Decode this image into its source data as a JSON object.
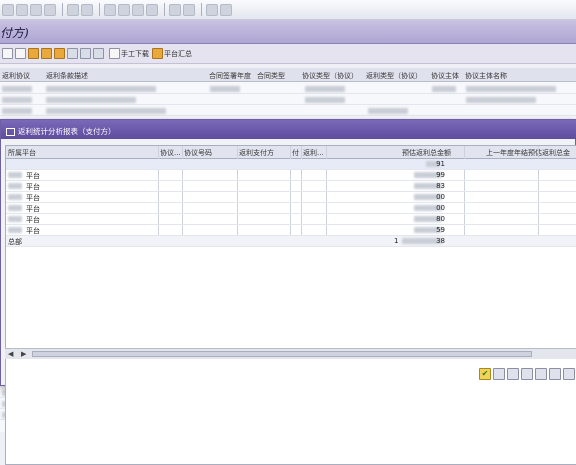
{
  "window": {
    "title": "付方)"
  },
  "toolbar": {
    "manual_download_label": "手工下载",
    "platform_summary_label": "平台汇总"
  },
  "background_table": {
    "columns": [
      "返利协议",
      "返利条款描述",
      "合同签署年度",
      "合同类型",
      "协议类型（协议）",
      "返利类型（协议）",
      "协议主体",
      "协议主体名称"
    ]
  },
  "dialog": {
    "title": "返利统计分析报表（支付方）",
    "columns": [
      "所属平台",
      "协议...",
      "协议号码",
      "返利支付方",
      "付",
      "返利...",
      "预估返利总金额",
      "上一年度年结预估返利总金"
    ],
    "rows": [
      {
        "platform": "",
        "amount_tail": "91"
      },
      {
        "platform": "平台",
        "amount_tail": "99"
      },
      {
        "platform": "平台",
        "amount_tail": "83"
      },
      {
        "platform": "平台",
        "amount_tail": "00"
      },
      {
        "platform": "平台",
        "amount_tail": "00"
      },
      {
        "platform": "平台",
        "amount_tail": "80"
      },
      {
        "platform": "平台",
        "amount_tail": "59"
      }
    ],
    "total": {
      "label": "总部",
      "amount_lead": "1",
      "amount_tail": "38"
    }
  },
  "icons": {
    "footer": [
      "check-icon",
      "find-icon",
      "sort-asc-icon",
      "sort-desc-icon",
      "filter-icon",
      "sum-icon",
      "export-icon"
    ]
  }
}
